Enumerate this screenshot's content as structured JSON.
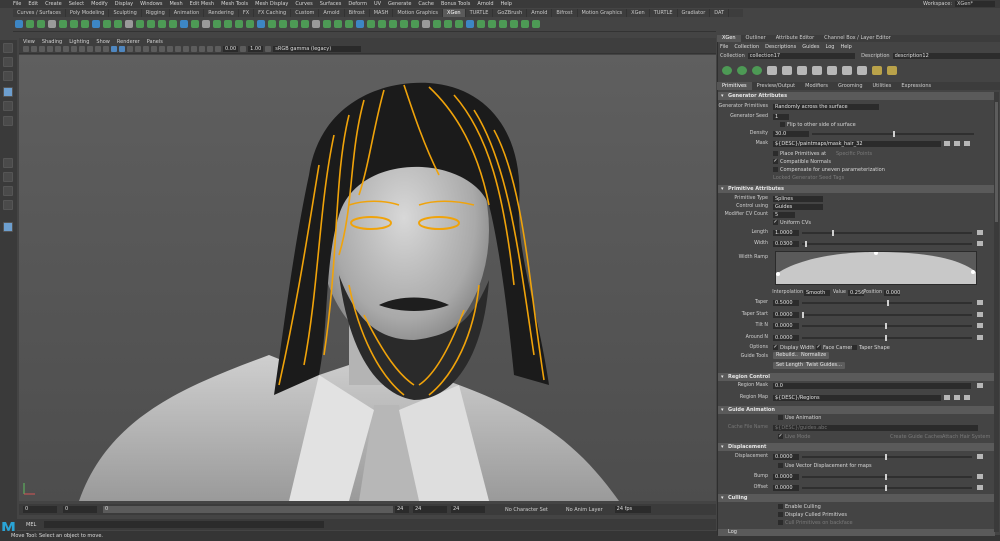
{
  "menubar": {
    "items": [
      "File",
      "Edit",
      "Create",
      "Select",
      "Modify",
      "Display",
      "Windows",
      "Mesh",
      "Edit Mesh",
      "Mesh Tools",
      "Mesh Display",
      "Curves",
      "Surfaces",
      "Deform",
      "UV",
      "Generate",
      "Cache",
      "Bonus Tools",
      "Arnold",
      "Help"
    ],
    "workspace_label": "Workspace:",
    "workspace_value": "XGen*"
  },
  "shelf_tabs": {
    "items": [
      "Curves / Surfaces",
      "Poly Modeling",
      "Sculpting",
      "Rigging",
      "Animation",
      "Rendering",
      "FX",
      "FX Caching",
      "Custom",
      "Arnold",
      "Bifrost",
      "MASH",
      "Motion Graphics",
      "XGen",
      "TURTLE",
      "GoZBrush",
      "Arnold",
      "Bifrost",
      "Motion Graphics",
      "XGen",
      "TURTLE",
      "Gradiator",
      "DAT"
    ],
    "active": "XGen"
  },
  "viewport": {
    "menu": [
      "View",
      "Shading",
      "Lighting",
      "Show",
      "Renderer",
      "Panels"
    ],
    "gamma_value": "1.00",
    "exposure_value": "0.00",
    "color_space": "sRGB gamma (legacy)"
  },
  "timeline": {
    "start": "0",
    "range_start": "0",
    "current": "0",
    "range_end": "24",
    "end_a": "24",
    "end_b": "24",
    "character_set": "No Character Set",
    "anim_layer": "No Anim Layer",
    "fps": "24 fps"
  },
  "cmdline": {
    "label": "MEL"
  },
  "helpline": {
    "text": "Move Tool: Select an object to move."
  },
  "panel": {
    "tabs": [
      "XGen",
      "Outliner",
      "Attribute Editor",
      "Channel Box / Layer Editor"
    ],
    "menu": [
      "File",
      "Collection",
      "Descriptions",
      "Guides",
      "Log",
      "Help"
    ],
    "collection_label": "Collection",
    "collection_value": "collection17",
    "description_label": "Description",
    "description_value": "description12",
    "subtabs": [
      "Primitives",
      "Preview/Output",
      "Modifiers",
      "Grooming",
      "Utilities",
      "Expressions"
    ],
    "active_subtab": "Primitives",
    "sections": {
      "generator": "Generator Attributes",
      "primitive": "Primitive Attributes",
      "region": "Region Control",
      "guide_anim": "Guide Animation",
      "displacement": "Displacement",
      "culling": "Culling",
      "log": "Log"
    },
    "gen": {
      "generator_label": "Generator Primitives",
      "generator_value": "Randomly across the surface",
      "seed_label": "Generator Seed",
      "seed_value": "1",
      "flip_label": "Flip to other side of surface",
      "density_label": "Density",
      "density_value": "30.0",
      "mask_label": "Mask",
      "mask_value": "${DESC}/paintmaps/mask_hair_32",
      "place_label": "Place Primitives at",
      "place_value": "Specific Points",
      "compatible_label": "Compatible Normals",
      "compensate_label": "Compensate for uneven parameterization",
      "locked_label": "Locked Generator Seed Tags"
    },
    "prim": {
      "type_label": "Primitive Type",
      "type_value": "Splines",
      "control_label": "Control using",
      "control_value": "Guides",
      "cvcount_label": "Modifier CV Count",
      "cvcount_value": "5",
      "uniform_label": "Uniform CVs",
      "length_label": "Length",
      "length_value": "1.0000",
      "width_label": "Width",
      "width_value": "0.0300",
      "widthramp_label": "Width Ramp",
      "interp_label": "Interpolation",
      "interp_value": "Smooth",
      "value_label": "Value",
      "value_value": "0.256",
      "position_label": "Position",
      "position_value": "0.000",
      "taper_label": "Taper",
      "taper_value": "0.5000",
      "taperstart_label": "Taper Start",
      "taperstart_value": "0.0000",
      "tiltn_label": "Tilt N",
      "tiltn_value": "0.0000",
      "aroundn_label": "Around N",
      "aroundn_value": "0.0000",
      "options_label": "Options",
      "display_width_label": "Display Width",
      "face_camera_label": "Face Camera",
      "taper_shape_label": "Taper Shape",
      "guide_tools_label": "Guide Tools",
      "rebuild_label": "Rebuild...",
      "normalize_label": "Normalize",
      "set_length_label": "Set Length...",
      "twist_label": "Twist Guides..."
    },
    "region": {
      "mask_label": "Region Mask",
      "mask_value": "0.0",
      "map_label": "Region Map",
      "map_value": "${DESC}/Regions"
    },
    "anim": {
      "use_anim_label": "Use Animation",
      "cache_label": "Cache File Name",
      "cache_value": "${DESC}/guides.abc",
      "live_mode_label": "Live Mode",
      "create_label": "Create Guide Caches",
      "attach_label": "Attach Hair System"
    },
    "disp": {
      "disp_label": "Displacement",
      "disp_value": "0.0000",
      "vector_label": "Use Vector Displacement for maps",
      "bump_label": "Bump",
      "bump_value": "0.0000",
      "offset_label": "Offset",
      "offset_value": "0.0000"
    },
    "cull": {
      "enable_label": "Enable Culling",
      "display_label": "Display Culled Primitives",
      "cull_label": "Cull Primitives on backface"
    }
  },
  "colors": {
    "hair_guides": "#f0a30a",
    "accent": "#2aa4d6",
    "shelf_icon": "#4d9a55"
  }
}
